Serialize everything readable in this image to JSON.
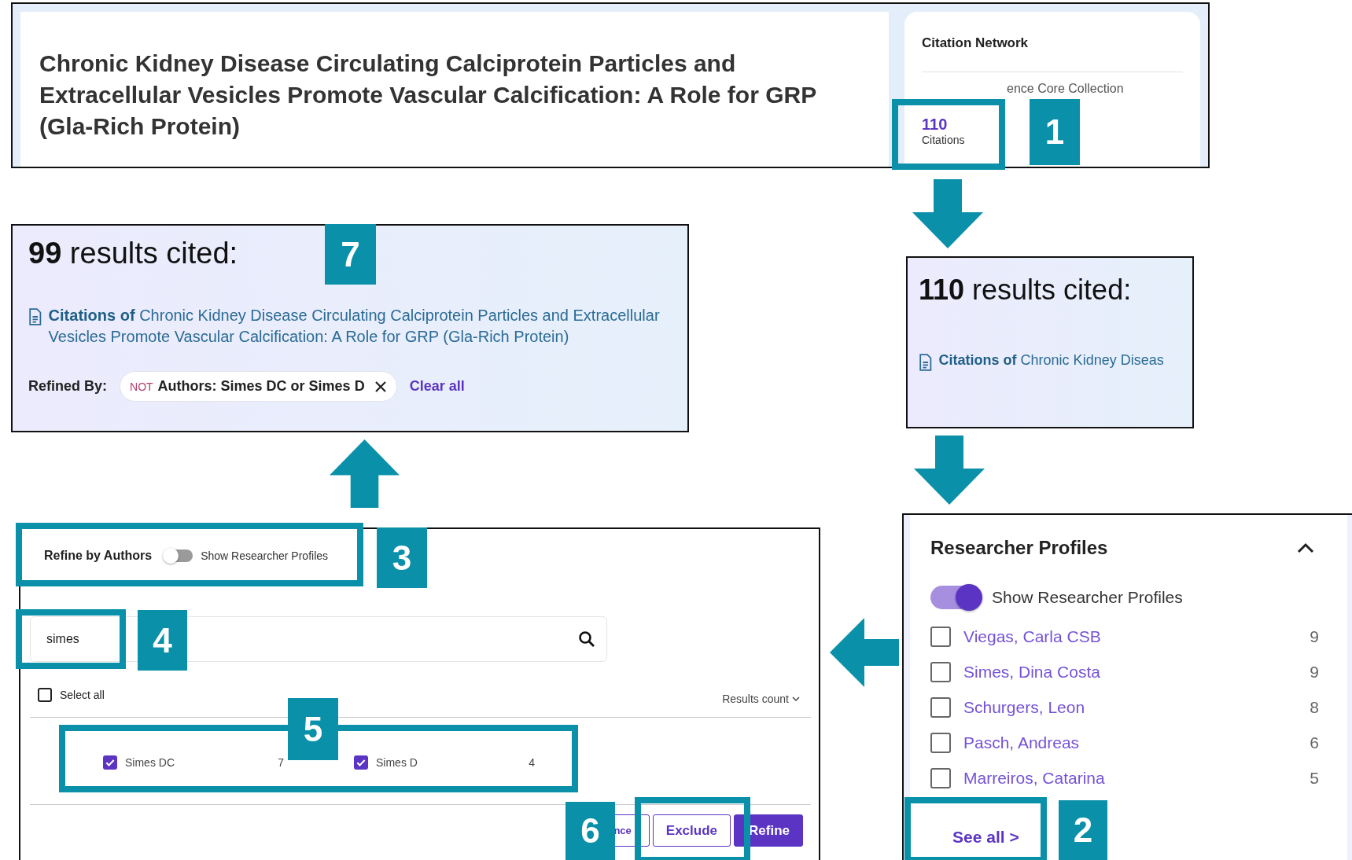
{
  "article_card": {
    "title": "Chronic Kidney Disease Circulating Calciprotein Particles and Extracellular Vesicles Promote Vascular Calcification: A Role for GRP (Gla-Rich Protein)",
    "citation_network": {
      "heading": "Citation Network",
      "source": "ence Core Collection",
      "count": "110",
      "count_label": "Citations"
    }
  },
  "cited_panel_all": {
    "heading": "**110** results cited:",
    "citations": "**Citations of** Chronic Kidney Diseas"
  },
  "researcher_profiles": {
    "heading": "Researcher Profiles",
    "expanded": true,
    "toggle": {
      "label": "Show Researcher Profiles",
      "on": true
    },
    "items": [
      {
        "name": "Viegas, Carla CSB",
        "count": "9",
        "checked": false
      },
      {
        "name": "Simes, Dina Costa",
        "count": "9",
        "checked": false
      },
      {
        "name": "Schurgers, Leon",
        "count": "8",
        "checked": false
      },
      {
        "name": "Pasch, Andreas",
        "count": "6",
        "checked": false
      },
      {
        "name": "Marreiros, Catarina",
        "count": "5",
        "checked": false
      }
    ],
    "see_all": "See all >"
  },
  "refine_authors": {
    "heading": "Refine by Authors",
    "toggle": {
      "label": "Show Researcher Profiles",
      "on": false
    },
    "search": {
      "value": "simes"
    },
    "select_all": {
      "label": "Select all",
      "checked": false
    },
    "sort": "Results count",
    "authors": [
      {
        "name": "Simes DC",
        "count": "7",
        "checked": true
      },
      {
        "name": "Simes D",
        "count": "4",
        "checked": true
      }
    ],
    "buttons": [
      {
        "label": "nce",
        "kind": "cut"
      },
      {
        "label": "Exclude",
        "kind": "outline"
      },
      {
        "label": "Refine",
        "kind": "primary"
      }
    ]
  },
  "cited_panel_refined": {
    "heading": "**99** results cited:",
    "citations": "**Citations of** Chronic Kidney Disease Circulating Calciprotein Particles and Extracellular Vesicles Promote Vascular Calcification: A Role for GRP (Gla-Rich Protein)",
    "refined_by_label": "Refined By:",
    "filter": {
      "operator": "NOT",
      "text": "Authors: Simes DC or Simes D"
    },
    "clear_all": "Clear all"
  },
  "steps": [
    {
      "number": "1"
    },
    {
      "number": "2"
    },
    {
      "number": "3"
    },
    {
      "number": "4"
    },
    {
      "number": "5"
    },
    {
      "number": "6"
    },
    {
      "number": "7"
    }
  ]
}
